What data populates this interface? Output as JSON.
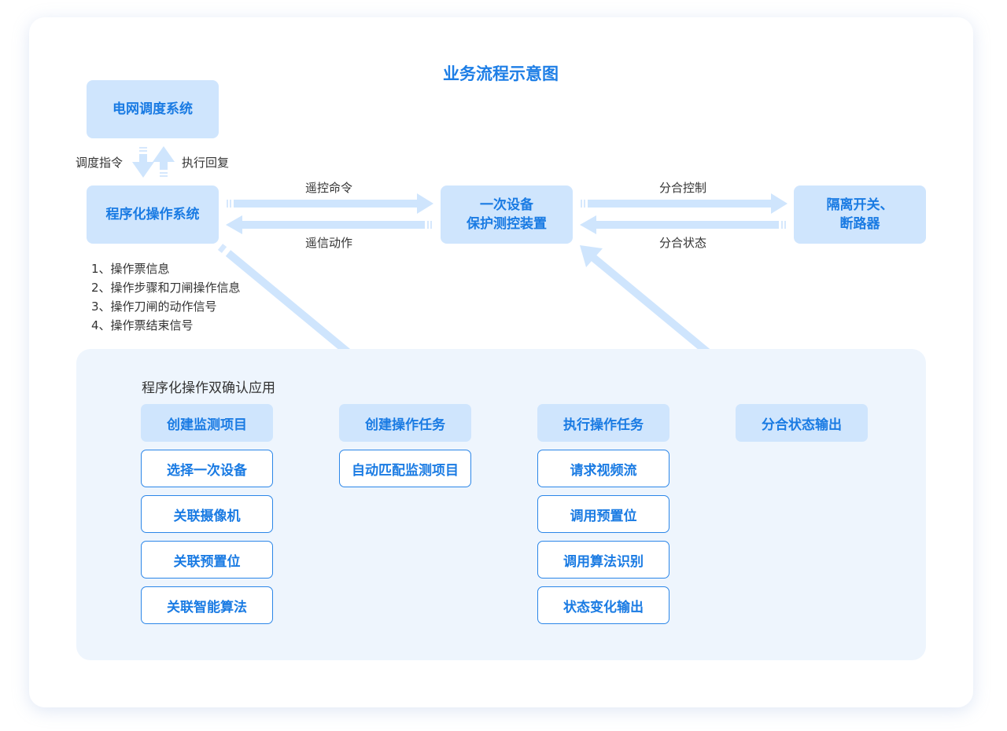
{
  "title": "业务流程示意图",
  "nodes": {
    "grid_dispatch": "电网调度系统",
    "program_op": "程序化操作系统",
    "primary_device": "一次设备\n保护测控装置",
    "isolator": "隔离开关、\n断路器"
  },
  "edge_labels": {
    "dispatch_cmd": "调度指令",
    "exec_reply": "执行回复",
    "remote_control": "遥控命令",
    "remote_signal": "遥信动作",
    "open_close_control": "分合控制",
    "open_close_state": "分合状态"
  },
  "notes": [
    "1、操作票信息",
    "2、操作步骤和刀闸操作信息",
    "3、操作刀闸的动作信号",
    "4、操作票结束信号"
  ],
  "panel": {
    "title": "程序化操作双确认应用",
    "columns": [
      {
        "header": "创建监测项目",
        "items": [
          "选择一次设备",
          "关联摄像机",
          "关联预置位",
          "关联智能算法"
        ]
      },
      {
        "header": "创建操作任务",
        "items": [
          "自动匹配监测项目"
        ]
      },
      {
        "header": "执行操作任务",
        "items": [
          "请求视频流",
          "调用预置位",
          "调用算法识别",
          "状态变化输出"
        ]
      },
      {
        "header": "分合状态输出",
        "items": []
      }
    ]
  },
  "colors": {
    "accent": "#1a7be3",
    "node_fill": "#cfe5fd",
    "arrow": "#cfe5fd",
    "panel_bg": "#eef5fd"
  }
}
